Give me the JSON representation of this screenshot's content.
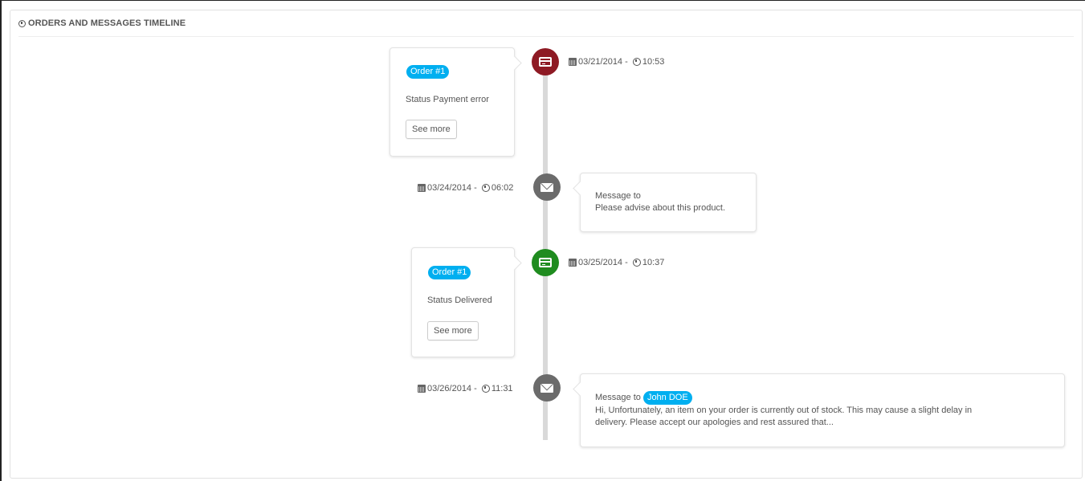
{
  "panel": {
    "title": "ORDERS AND MESSAGES TIMELINE"
  },
  "colors": {
    "payment_error": "#8e1a24",
    "delivered": "#1f8c1f",
    "message": "#6b6b6b",
    "badge": "#00aff0"
  },
  "events": [
    {
      "type": "order",
      "icon": "credit-card-icon",
      "date": "03/21/2014",
      "time": "10:53",
      "separator": " - ",
      "badge": "Order #1",
      "status": "Status Payment error",
      "button": "See more"
    },
    {
      "type": "message",
      "icon": "envelope-icon",
      "date": "03/24/2014",
      "time": "06:02",
      "separator": " - ",
      "prefix": "Message to",
      "text": "Please advise about this product."
    },
    {
      "type": "order",
      "icon": "credit-card-icon",
      "date": "03/25/2014",
      "time": "10:37",
      "separator": " - ",
      "badge": "Order #1",
      "status": "Status Delivered",
      "button": "See more"
    },
    {
      "type": "message",
      "icon": "envelope-icon",
      "date": "03/26/2014",
      "time": "11:31",
      "separator": " - ",
      "prefix": "Message to",
      "recipient": "John DOE",
      "text_line1": "Hi, Unfortunately, an item on your order is currently out of stock. This may cause a slight delay in",
      "text_line2": "delivery. Please accept our apologies and rest assured that..."
    }
  ]
}
